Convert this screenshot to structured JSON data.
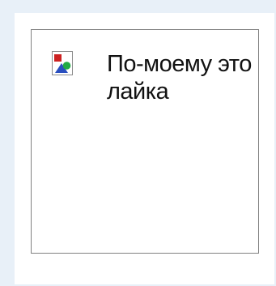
{
  "image_placeholder": {
    "alt_text": "По-моему это лайка",
    "icon": "broken-image-icon"
  },
  "colors": {
    "page_background": "#e8f0f8",
    "placeholder_border": "#808080",
    "icon_red": "#cc2222",
    "icon_blue": "#2a4fbf",
    "icon_green": "#22aa44"
  }
}
